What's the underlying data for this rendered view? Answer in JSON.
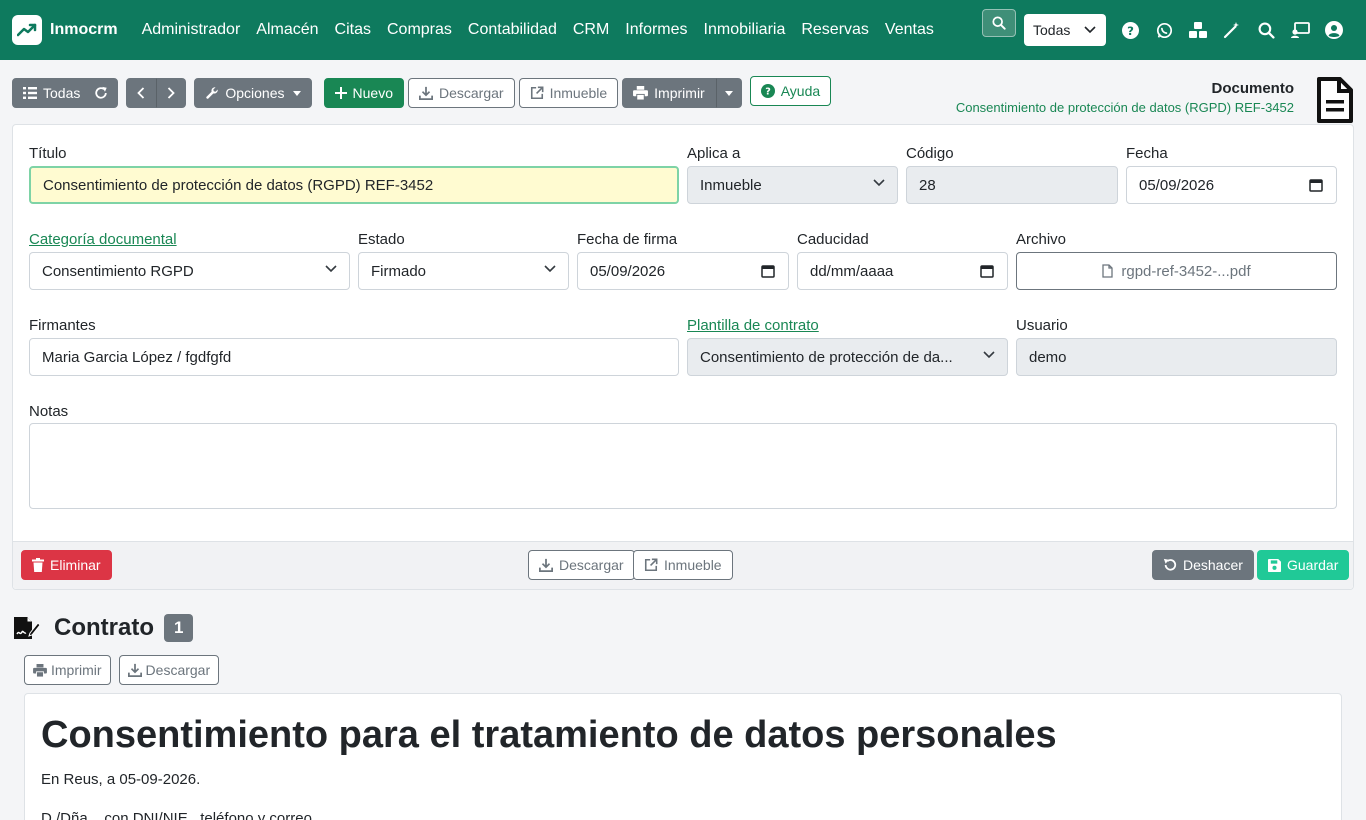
{
  "brand": {
    "name": "Inmocrm"
  },
  "nav": {
    "menu": [
      "Administrador",
      "Almacén",
      "Citas",
      "Compras",
      "Contabilidad",
      "CRM",
      "Informes",
      "Inmobiliaria",
      "Reservas",
      "Ventas"
    ],
    "scope_select": "Todas",
    "icons": [
      "help-icon",
      "whatsapp-icon",
      "cubes-icon",
      "magic-wand-icon",
      "search-icon",
      "user-monitor-icon",
      "user-circle-icon"
    ]
  },
  "toolbar": {
    "todas": "Todas",
    "opciones": "Opciones",
    "nuevo": "Nuevo",
    "descargar": "Descargar",
    "inmueble": "Inmueble",
    "imprimir": "Imprimir",
    "ayuda": "Ayuda"
  },
  "doc_header": {
    "title": "Documento",
    "subtitle": "Consentimiento de protección de datos (RGPD) REF-3452"
  },
  "form": {
    "titulo": {
      "label": "Título",
      "value": "Consentimiento de protección de datos (RGPD) REF-3452"
    },
    "aplica_a": {
      "label": "Aplica a",
      "value": "Inmueble"
    },
    "codigo": {
      "label": "Código",
      "value": "28"
    },
    "fecha": {
      "label": "Fecha",
      "value": "05/09/2026"
    },
    "categoria": {
      "label": "Categoría documental",
      "value": "Consentimiento RGPD"
    },
    "estado": {
      "label": "Estado",
      "value": "Firmado"
    },
    "fecha_firma": {
      "label": "Fecha de firma",
      "value": "05/09/2026"
    },
    "caducidad": {
      "label": "Caducidad",
      "placeholder": "dd/mm/aaaa"
    },
    "archivo": {
      "label": "Archivo",
      "value": "rgpd-ref-3452-...pdf"
    },
    "firmantes": {
      "label": "Firmantes",
      "value": "Maria Garcia López / fgdfgfd"
    },
    "plantilla": {
      "label": "Plantilla de contrato",
      "value": "Consentimiento de protección de da..."
    },
    "usuario": {
      "label": "Usuario",
      "value": "demo"
    },
    "notas": {
      "label": "Notas",
      "value": ""
    }
  },
  "footer": {
    "eliminar": "Eliminar",
    "descargar": "Descargar",
    "inmueble": "Inmueble",
    "deshacer": "Deshacer",
    "guardar": "Guardar"
  },
  "contrato": {
    "title": "Contrato",
    "count": "1",
    "imprimir": "Imprimir",
    "descargar": "Descargar",
    "preview_title": "Consentimiento para el tratamiento de datos personales",
    "preview_line1": "En Reus, a 05-09-2026.",
    "preview_line2": "D./Dña. , con DNI/NIE , teléfono y correo"
  },
  "colors": {
    "navbar": "#0e7a5e",
    "primary_green": "#198754",
    "gray": "#6c757d",
    "danger": "#dc3545",
    "teal": "#20c997"
  }
}
